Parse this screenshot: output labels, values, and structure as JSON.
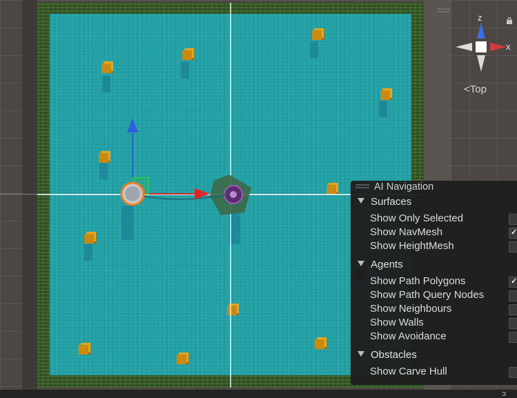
{
  "scene_view": {
    "gizmo": {
      "axis_y_label": "z",
      "axis_x_label": "x",
      "view_label": "Top",
      "view_icon": "perspective-chevron-icon",
      "colors": {
        "y_cone": "#3a6fe0",
        "x_cone": "#d23b3b",
        "neutral_cone": "#dcdcdc"
      }
    },
    "navmesh_color": "#18bed7",
    "agent_color": "#f07a1e",
    "handle_colors": {
      "up_arrow": "#2f5fe0",
      "right_arrow": "#d82a2a",
      "plane": "#30d030"
    },
    "obstacle_color": "#c98a10"
  },
  "ai_navigation": {
    "title": "AI Navigation",
    "sections": [
      {
        "label": "Surfaces",
        "options": [
          {
            "label": "Show Only Selected",
            "checked": false
          },
          {
            "label": "Show NavMesh",
            "checked": true
          },
          {
            "label": "Show HeightMesh",
            "checked": false
          }
        ]
      },
      {
        "label": "Agents",
        "options": [
          {
            "label": "Show Path Polygons",
            "checked": true
          },
          {
            "label": "Show Path Query Nodes",
            "checked": false
          },
          {
            "label": "Show Neighbours",
            "checked": false
          },
          {
            "label": "Show Walls",
            "checked": false
          },
          {
            "label": "Show Avoidance",
            "checked": false
          }
        ]
      },
      {
        "label": "Obstacles",
        "options": [
          {
            "label": "Show Carve Hull",
            "checked": false
          }
        ]
      }
    ]
  },
  "status_bar": {
    "indicator": "ↄ"
  }
}
